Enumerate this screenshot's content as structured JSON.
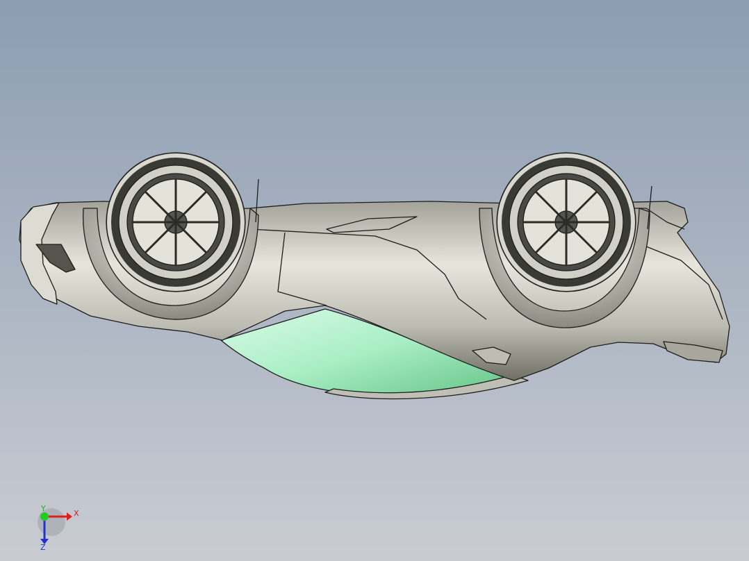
{
  "viewport": {
    "background_top": "#8c9db2",
    "background_bottom": "#c9ccd2",
    "model": {
      "name": "car-model-upside-down",
      "body_color": "#c9c9c0",
      "body_shade": "#7e7e74",
      "glass_color": "#b8f2d0",
      "glass_shade": "#66c487",
      "edge_color": "#1c1c1c"
    }
  },
  "triad": {
    "x_label": "X",
    "y_label": "Y",
    "z_label": "Z",
    "x_color": "#e02020",
    "y_color": "#22cc22",
    "z_color": "#2233cc"
  }
}
